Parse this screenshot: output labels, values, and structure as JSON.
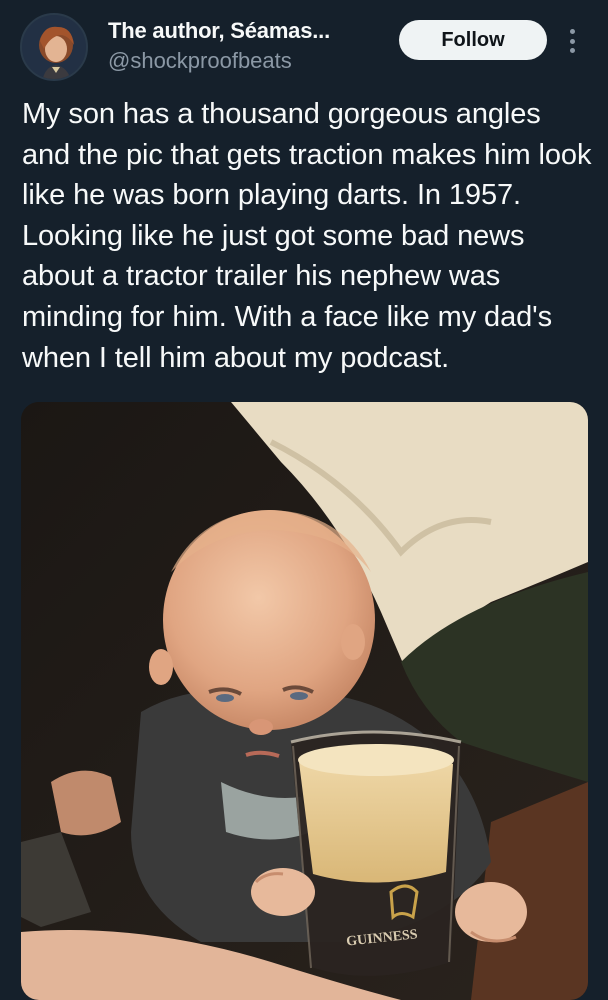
{
  "header": {
    "display_name": "The author, Séamas...",
    "handle": "@shockproofbeats",
    "follow_label": "Follow",
    "avatar_icon": "user-avatar-icon",
    "more_icon": "more-options-icon"
  },
  "tweet": {
    "text": "My son has a thousand gorgeous angles and the pic that gets traction makes him look like he was born playing darts. In 1957. Looking like he just got some bad news about a tractor trailer his nephew was minding for him. With a face like my dad's when I tell him about my podcast."
  },
  "media": {
    "glass_brand": "GUINNESS"
  },
  "colors": {
    "background": "#15202b",
    "text_primary": "#f7f9f9",
    "text_secondary": "#8b98a5",
    "button_bg": "#eff3f4"
  }
}
